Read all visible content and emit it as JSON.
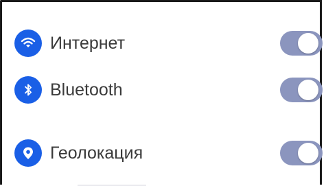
{
  "colors": {
    "accent": "#1a5fe6",
    "toggle_track": "#8b95be",
    "label_text": "#3a3a3a",
    "border": "#1a1a1a"
  },
  "settings": {
    "items": [
      {
        "label": "Интернет",
        "icon": "wifi-icon",
        "enabled": true
      },
      {
        "label": "Bluetooth",
        "icon": "bluetooth-icon",
        "enabled": true
      },
      {
        "label": "Геолокация",
        "icon": "location-pin-icon",
        "enabled": true
      }
    ]
  }
}
